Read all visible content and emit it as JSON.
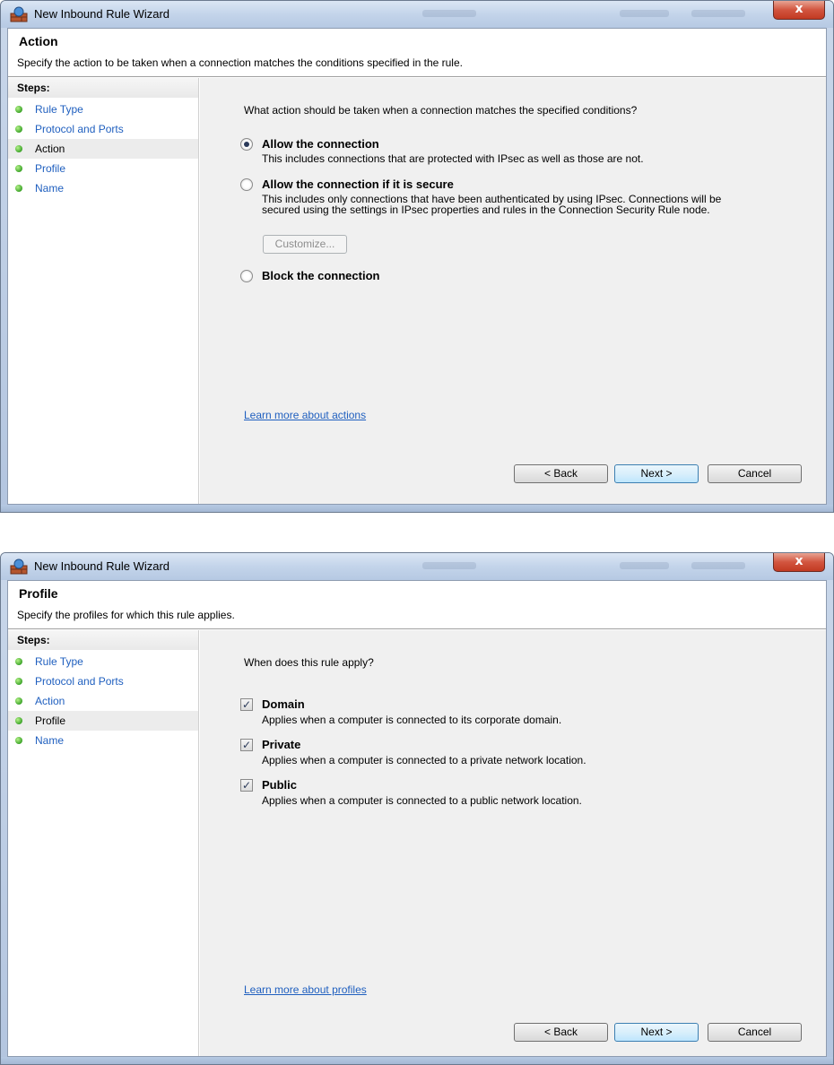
{
  "windows": [
    {
      "title": "New Inbound Rule Wizard",
      "close_symbol": "x",
      "header": {
        "title": "Action",
        "subtitle": "Specify the action to be taken when a connection matches the conditions specified in the rule."
      },
      "steps_label": "Steps:",
      "steps": [
        "Rule Type",
        "Protocol and Ports",
        "Action",
        "Profile",
        "Name"
      ],
      "active_step": "Action",
      "question": "What action should be taken when a connection matches the specified conditions?",
      "options": [
        {
          "title": "Allow the connection",
          "desc": "This includes connections that are protected with IPsec as well as those are not.",
          "selected": true
        },
        {
          "title": "Allow the connection if it is secure",
          "desc": "This includes only connections that have been authenticated by using IPsec.  Connections will be secured using the settings in IPsec properties and rules in the Connection Security Rule node.",
          "selected": false
        },
        {
          "title": "Block the connection",
          "desc": "",
          "selected": false
        }
      ],
      "customize_label": "Customize...",
      "learn_more": "Learn more about actions",
      "buttons": {
        "back": "< Back",
        "next": "Next >",
        "cancel": "Cancel"
      }
    },
    {
      "title": "New Inbound Rule Wizard",
      "close_symbol": "x",
      "header": {
        "title": "Profile",
        "subtitle": "Specify the profiles for which this rule applies."
      },
      "steps_label": "Steps:",
      "steps": [
        "Rule Type",
        "Protocol and Ports",
        "Action",
        "Profile",
        "Name"
      ],
      "active_step": "Profile",
      "question": "When does this rule apply?",
      "options": [
        {
          "title": "Domain",
          "desc": "Applies when a computer is connected to its corporate domain.",
          "checked": true
        },
        {
          "title": "Private",
          "desc": "Applies when a computer is connected to a private network location.",
          "checked": true
        },
        {
          "title": "Public",
          "desc": "Applies when a computer is connected to a public network location.",
          "checked": true
        }
      ],
      "check_symbol": "✓",
      "learn_more": "Learn more about profiles",
      "buttons": {
        "back": "< Back",
        "next": "Next >",
        "cancel": "Cancel"
      }
    }
  ]
}
